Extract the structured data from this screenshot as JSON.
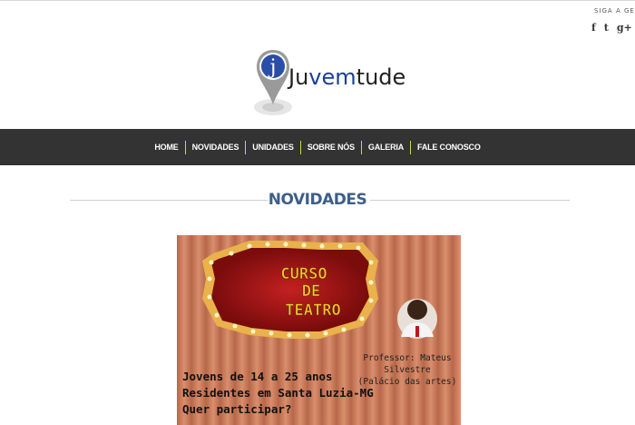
{
  "header": {
    "follow_text": "SIGA A GENTE",
    "social": [
      {
        "icon": "facebook-icon",
        "glyph": "f"
      },
      {
        "icon": "twitter-icon",
        "glyph": "t"
      },
      {
        "icon": "google-plus-icon",
        "glyph": "g+"
      }
    ],
    "logo": {
      "letter": "j",
      "name_pre": "Ju",
      "name_mid": "vem",
      "name_post": "tude"
    }
  },
  "nav": {
    "items": [
      "HOME",
      "NOVIDADES",
      "UNIDADES",
      "SOBRE NÓS",
      "GALERIA",
      "FALE CONOSCO"
    ]
  },
  "section": {
    "title": "NOVIDADES"
  },
  "banner": {
    "sign_line1": "CURSO",
    "sign_line2": "DE",
    "sign_line3": "TEATRO",
    "professor": "Professor: Mateus Silvestre",
    "venue": "(Palácio das artes)",
    "line1": "Jovens de 14 a 25 anos",
    "line2": "Residentes em Santa Luzia-MG",
    "line3": "Quer participar?"
  },
  "colors": {
    "nav_bg": "#333333",
    "nav_separator": "#c8d84a",
    "title": "#3d5f8a",
    "curtain": "#c97a5a"
  }
}
